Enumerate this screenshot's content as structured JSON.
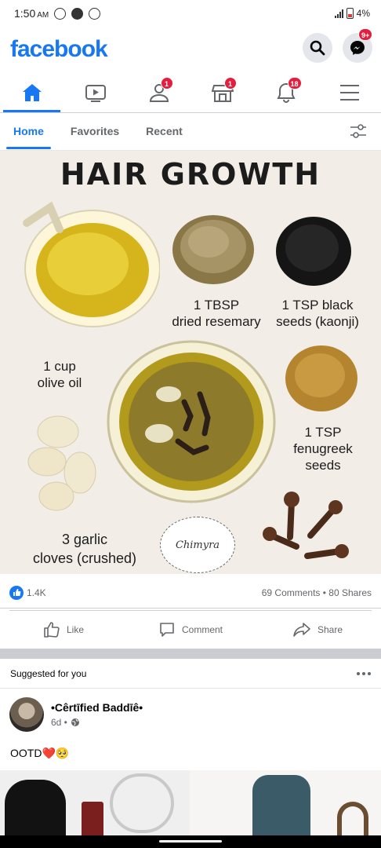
{
  "status_bar": {
    "time": "1:50",
    "ampm": "AM",
    "battery": "4%"
  },
  "header": {
    "logo": "facebook",
    "messenger_badge": "9+"
  },
  "nav": {
    "friends_badge": "1",
    "marketplace_badge": "1",
    "notifications_badge": "18"
  },
  "subtabs": [
    "Home",
    "Favorites",
    "Recent"
  ],
  "post_image": {
    "title": "HAIR GROWTH",
    "labels": {
      "rosemary": [
        "1 TBSP",
        "dried resemary"
      ],
      "black_seeds": [
        "1 TSP black",
        "seeds (kaonji)"
      ],
      "olive_oil": [
        "1 cup",
        "olive oil"
      ],
      "fenugreek": [
        "1 TSP",
        "fenugreek",
        "seeds"
      ],
      "garlic": [
        "3 garlic",
        "cloves (crushed)"
      ],
      "signature": "Chimyra"
    }
  },
  "stats": {
    "likes": "1.4K",
    "comments_shares": "69 Comments • 80 Shares"
  },
  "actions": {
    "like": "Like",
    "comment": "Comment",
    "share": "Share"
  },
  "suggested": {
    "label": "Suggested for you"
  },
  "post2": {
    "author": "•Cêrtīfied Baddīê•",
    "time": "6d •",
    "text": "OOTD❤️🥺"
  },
  "colors": {
    "brand": "#1877f2",
    "badge": "#e41e3f"
  }
}
